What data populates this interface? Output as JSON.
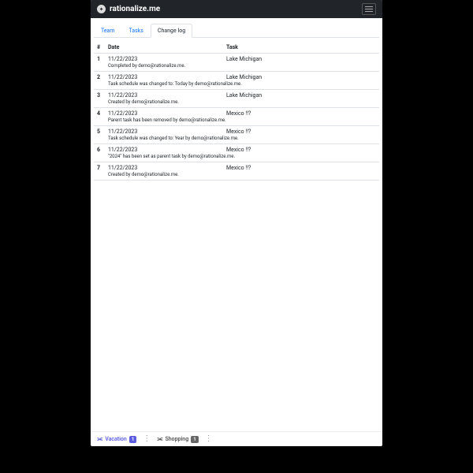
{
  "brand": "rationalize.me",
  "tabs": [
    {
      "label": "Team",
      "active": false
    },
    {
      "label": "Tasks",
      "active": false
    },
    {
      "label": "Change log",
      "active": true
    }
  ],
  "columns": {
    "num": "#",
    "date": "Date",
    "task": "Task"
  },
  "rows": [
    {
      "n": "1",
      "date": "11/22/2023",
      "task": "Lake Michigan",
      "detail": "Completed by demo@rationalize.me."
    },
    {
      "n": "2",
      "date": "11/22/2023",
      "task": "Lake Michigan",
      "detail": "Task schedule was changed to: Today by demo@rationalize.me."
    },
    {
      "n": "3",
      "date": "11/22/2023",
      "task": "Lake Michigan",
      "detail": "Created by demo@rationalize.me."
    },
    {
      "n": "4",
      "date": "11/22/2023",
      "task": "Mexico !!?",
      "detail": "Parent task has been removed by demo@rationalize.me."
    },
    {
      "n": "5",
      "date": "11/22/2023",
      "task": "Mexico !!?",
      "detail": "Task schedule was changed to: Year by demo@rationalize.me."
    },
    {
      "n": "6",
      "date": "11/22/2023",
      "task": "Mexico !!?",
      "detail": "\"2024\" has been set as parent task by demo@rationalize.me."
    },
    {
      "n": "7",
      "date": "11/22/2023",
      "task": "Mexico !!?",
      "detail": "Created by demo@rationalize.me."
    }
  ],
  "footer": [
    {
      "label": "Vacation",
      "count": "1",
      "style": "purple"
    },
    {
      "label": "Shopping",
      "count": "1",
      "style": "gray"
    }
  ]
}
